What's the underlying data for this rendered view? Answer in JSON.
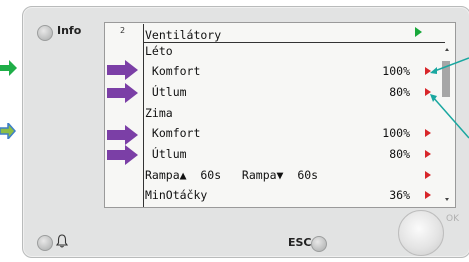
{
  "device": {
    "info_label": "Info",
    "esc_label": "ESC",
    "ok_label": "OK"
  },
  "screen": {
    "page_number": "2",
    "title": "Ventilátory",
    "rows": [
      {
        "label": "Léto",
        "value": "",
        "arrow": false
      },
      {
        "label": " Komfort",
        "value": "100%",
        "arrow": true
      },
      {
        "label": " Útlum",
        "value": "80%",
        "arrow": true
      },
      {
        "label": "Zima",
        "value": "",
        "arrow": false
      },
      {
        "label": " Komfort",
        "value": "100%",
        "arrow": true
      },
      {
        "label": " Útlum",
        "value": "80%",
        "arrow": true
      },
      {
        "label": "Rampa▲  60s   Rampa▼  60s",
        "value": "",
        "arrow": true
      },
      {
        "label": "MinOtáčky",
        "value": "36%",
        "arrow": true
      }
    ]
  },
  "colors": {
    "green_arrow": "#18a83a",
    "red_arrow": "#d8262a",
    "purple_marker": "#7b3fa6",
    "teal_arrow": "#1aa7a0",
    "blue_arrow": "#3d7fc8"
  },
  "icons": {
    "bell": "bell-icon"
  }
}
